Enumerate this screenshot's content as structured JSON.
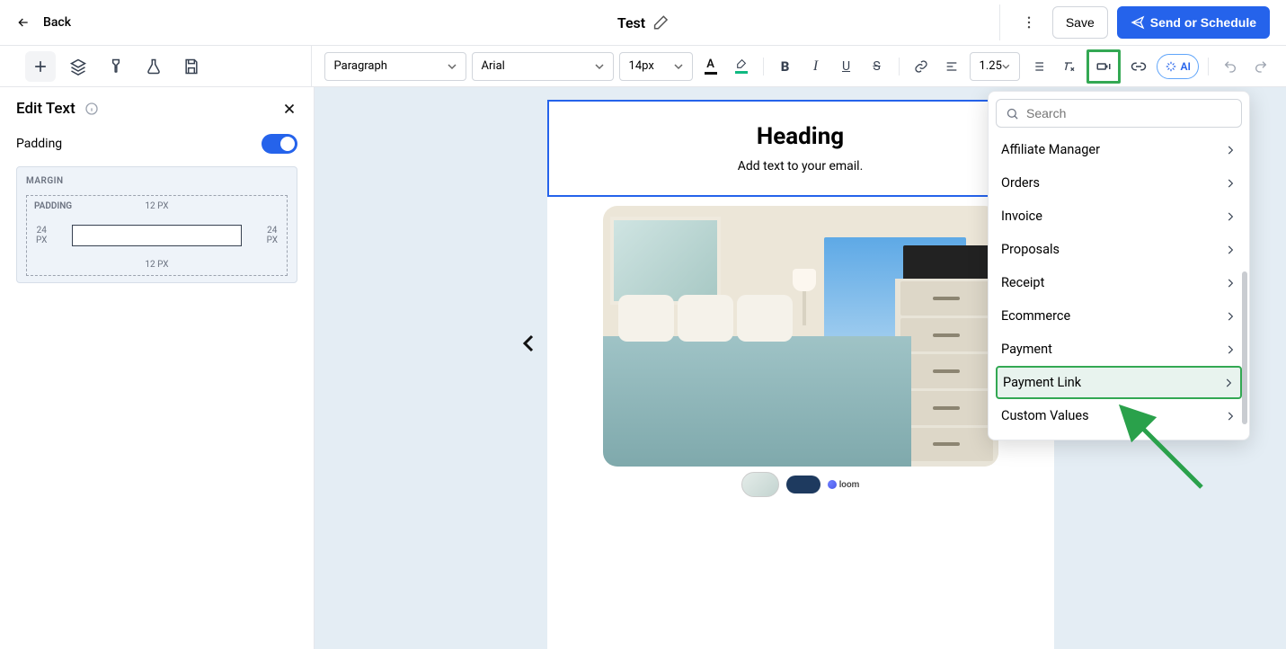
{
  "header": {
    "back": "Back",
    "title": "Test",
    "save": "Save",
    "send": "Send or Schedule"
  },
  "format_toolbar": {
    "block_type": "Paragraph",
    "font_family": "Arial",
    "font_size": "14px",
    "line_height": "1.25",
    "ai_label": "AI"
  },
  "panel": {
    "title": "Edit Text",
    "padding_label": "Padding",
    "padding_on": true,
    "box": {
      "margin_label": "MARGIN",
      "padding_label": "PADDING",
      "top": "12 PX",
      "bottom": "12 PX",
      "left_value": "24",
      "left_unit": "PX",
      "right_value": "24",
      "right_unit": "PX"
    }
  },
  "email": {
    "heading": "Heading",
    "subtext": "Add text to your email.",
    "loom_label": "loom"
  },
  "merge_menu": {
    "search_placeholder": "Search",
    "items": [
      "Affiliate Manager",
      "Orders",
      "Invoice",
      "Proposals",
      "Receipt",
      "Ecommerce",
      "Payment",
      "Payment Link",
      "Custom Values"
    ],
    "highlight_index": 7
  }
}
